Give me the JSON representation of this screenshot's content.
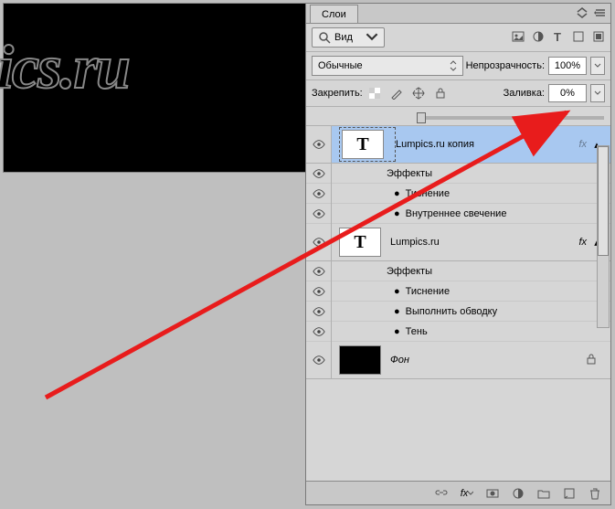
{
  "panel": {
    "tab_label": "Слои"
  },
  "filter": {
    "label": "Вид"
  },
  "blend": {
    "mode": "Обычные"
  },
  "opacity": {
    "label": "Непрозрачность:",
    "value": "100%"
  },
  "lock": {
    "label": "Закрепить:"
  },
  "fill": {
    "label": "Заливка:",
    "value": "0%"
  },
  "layers": [
    {
      "name": "Lumpics.ru копия",
      "selected": true,
      "type": "text",
      "effects_label": "Эффекты",
      "effects": [
        "Тиснение",
        "Внутреннее свечение"
      ]
    },
    {
      "name": "Lumpics.ru",
      "selected": false,
      "type": "text",
      "effects_label": "Эффекты",
      "effects": [
        "Тиснение",
        "Выполнить обводку",
        "Тень"
      ]
    },
    {
      "name": "Фон",
      "selected": false,
      "type": "bg",
      "locked": true
    }
  ],
  "canvas_text": "pics.ru",
  "fx_label": "fx"
}
